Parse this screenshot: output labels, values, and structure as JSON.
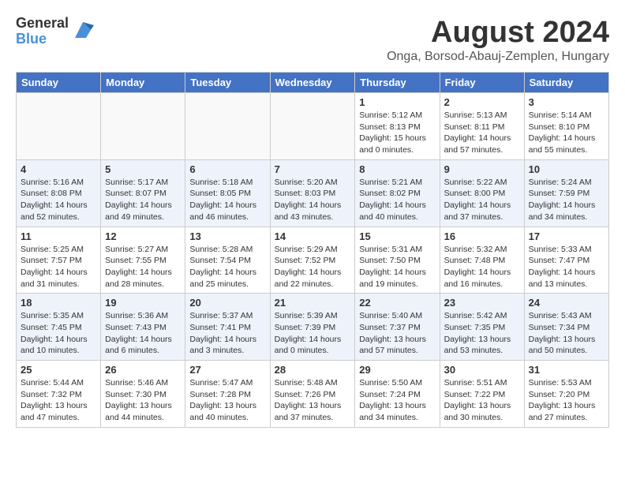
{
  "header": {
    "logo_general": "General",
    "logo_blue": "Blue",
    "main_title": "August 2024",
    "subtitle": "Onga, Borsod-Abauj-Zemplen, Hungary"
  },
  "calendar": {
    "headers": [
      "Sunday",
      "Monday",
      "Tuesday",
      "Wednesday",
      "Thursday",
      "Friday",
      "Saturday"
    ],
    "weeks": [
      [
        {
          "day": "",
          "info": ""
        },
        {
          "day": "",
          "info": ""
        },
        {
          "day": "",
          "info": ""
        },
        {
          "day": "",
          "info": ""
        },
        {
          "day": "1",
          "info": "Sunrise: 5:12 AM\nSunset: 8:13 PM\nDaylight: 15 hours\nand 0 minutes."
        },
        {
          "day": "2",
          "info": "Sunrise: 5:13 AM\nSunset: 8:11 PM\nDaylight: 14 hours\nand 57 minutes."
        },
        {
          "day": "3",
          "info": "Sunrise: 5:14 AM\nSunset: 8:10 PM\nDaylight: 14 hours\nand 55 minutes."
        }
      ],
      [
        {
          "day": "4",
          "info": "Sunrise: 5:16 AM\nSunset: 8:08 PM\nDaylight: 14 hours\nand 52 minutes."
        },
        {
          "day": "5",
          "info": "Sunrise: 5:17 AM\nSunset: 8:07 PM\nDaylight: 14 hours\nand 49 minutes."
        },
        {
          "day": "6",
          "info": "Sunrise: 5:18 AM\nSunset: 8:05 PM\nDaylight: 14 hours\nand 46 minutes."
        },
        {
          "day": "7",
          "info": "Sunrise: 5:20 AM\nSunset: 8:03 PM\nDaylight: 14 hours\nand 43 minutes."
        },
        {
          "day": "8",
          "info": "Sunrise: 5:21 AM\nSunset: 8:02 PM\nDaylight: 14 hours\nand 40 minutes."
        },
        {
          "day": "9",
          "info": "Sunrise: 5:22 AM\nSunset: 8:00 PM\nDaylight: 14 hours\nand 37 minutes."
        },
        {
          "day": "10",
          "info": "Sunrise: 5:24 AM\nSunset: 7:59 PM\nDaylight: 14 hours\nand 34 minutes."
        }
      ],
      [
        {
          "day": "11",
          "info": "Sunrise: 5:25 AM\nSunset: 7:57 PM\nDaylight: 14 hours\nand 31 minutes."
        },
        {
          "day": "12",
          "info": "Sunrise: 5:27 AM\nSunset: 7:55 PM\nDaylight: 14 hours\nand 28 minutes."
        },
        {
          "day": "13",
          "info": "Sunrise: 5:28 AM\nSunset: 7:54 PM\nDaylight: 14 hours\nand 25 minutes."
        },
        {
          "day": "14",
          "info": "Sunrise: 5:29 AM\nSunset: 7:52 PM\nDaylight: 14 hours\nand 22 minutes."
        },
        {
          "day": "15",
          "info": "Sunrise: 5:31 AM\nSunset: 7:50 PM\nDaylight: 14 hours\nand 19 minutes."
        },
        {
          "day": "16",
          "info": "Sunrise: 5:32 AM\nSunset: 7:48 PM\nDaylight: 14 hours\nand 16 minutes."
        },
        {
          "day": "17",
          "info": "Sunrise: 5:33 AM\nSunset: 7:47 PM\nDaylight: 14 hours\nand 13 minutes."
        }
      ],
      [
        {
          "day": "18",
          "info": "Sunrise: 5:35 AM\nSunset: 7:45 PM\nDaylight: 14 hours\nand 10 minutes."
        },
        {
          "day": "19",
          "info": "Sunrise: 5:36 AM\nSunset: 7:43 PM\nDaylight: 14 hours\nand 6 minutes."
        },
        {
          "day": "20",
          "info": "Sunrise: 5:37 AM\nSunset: 7:41 PM\nDaylight: 14 hours\nand 3 minutes."
        },
        {
          "day": "21",
          "info": "Sunrise: 5:39 AM\nSunset: 7:39 PM\nDaylight: 14 hours\nand 0 minutes."
        },
        {
          "day": "22",
          "info": "Sunrise: 5:40 AM\nSunset: 7:37 PM\nDaylight: 13 hours\nand 57 minutes."
        },
        {
          "day": "23",
          "info": "Sunrise: 5:42 AM\nSunset: 7:35 PM\nDaylight: 13 hours\nand 53 minutes."
        },
        {
          "day": "24",
          "info": "Sunrise: 5:43 AM\nSunset: 7:34 PM\nDaylight: 13 hours\nand 50 minutes."
        }
      ],
      [
        {
          "day": "25",
          "info": "Sunrise: 5:44 AM\nSunset: 7:32 PM\nDaylight: 13 hours\nand 47 minutes."
        },
        {
          "day": "26",
          "info": "Sunrise: 5:46 AM\nSunset: 7:30 PM\nDaylight: 13 hours\nand 44 minutes."
        },
        {
          "day": "27",
          "info": "Sunrise: 5:47 AM\nSunset: 7:28 PM\nDaylight: 13 hours\nand 40 minutes."
        },
        {
          "day": "28",
          "info": "Sunrise: 5:48 AM\nSunset: 7:26 PM\nDaylight: 13 hours\nand 37 minutes."
        },
        {
          "day": "29",
          "info": "Sunrise: 5:50 AM\nSunset: 7:24 PM\nDaylight: 13 hours\nand 34 minutes."
        },
        {
          "day": "30",
          "info": "Sunrise: 5:51 AM\nSunset: 7:22 PM\nDaylight: 13 hours\nand 30 minutes."
        },
        {
          "day": "31",
          "info": "Sunrise: 5:53 AM\nSunset: 7:20 PM\nDaylight: 13 hours\nand 27 minutes."
        }
      ]
    ]
  }
}
